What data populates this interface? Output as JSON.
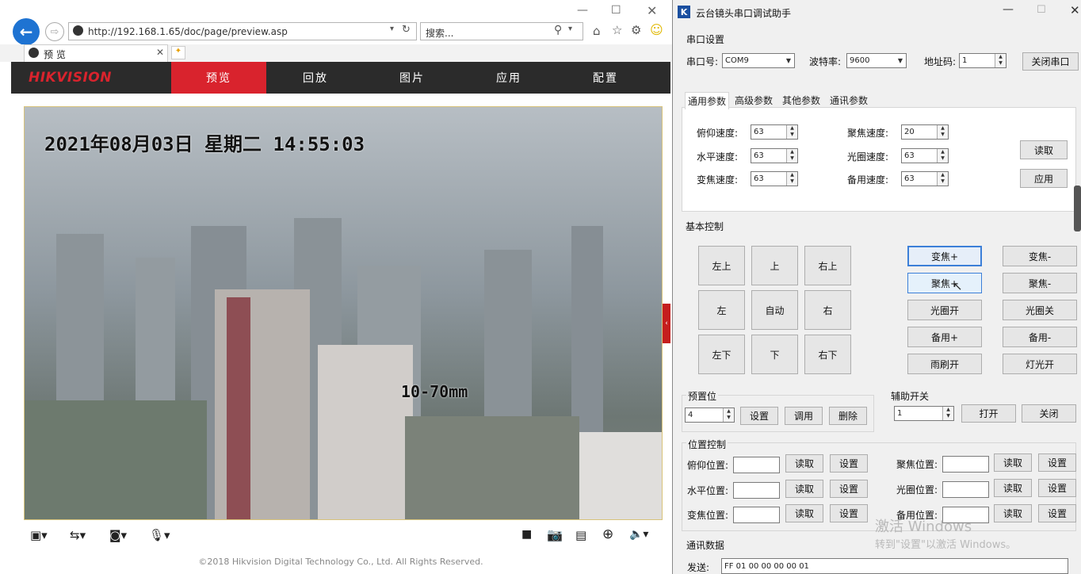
{
  "browser": {
    "url": "http://192.168.1.65/doc/page/preview.asp",
    "search_placeholder": "搜索...",
    "tab_label": "预 览",
    "back_glyph": "←",
    "forward_glyph": "⇨"
  },
  "hik": {
    "logo": "HIKVISION",
    "nav": [
      "预览",
      "回放",
      "图片",
      "应用",
      "配置"
    ],
    "active_nav": 0,
    "accent": "#d9232d",
    "osd_time": "2021年08月03日 星期二 14:55:03",
    "osd_lens": "10-70mm",
    "copyright": "©2018 Hikvision Digital Technology Co., Ltd. All Rights Reserved."
  },
  "app": {
    "title": "云台镜头串口调试助手",
    "serial": {
      "group_label": "串口设置",
      "port_label": "串口号:",
      "port_value": "COM9",
      "baud_label": "波特率:",
      "baud_value": "9600",
      "addr_label": "地址码:",
      "addr_value": "1",
      "close_button": "关闭串口"
    },
    "param_tabs": [
      "通用参数",
      "高级参数",
      "其他参数",
      "通讯参数"
    ],
    "active_tab": 0,
    "params_left": [
      {
        "label": "俯仰速度:",
        "value": "63"
      },
      {
        "label": "水平速度:",
        "value": "63"
      },
      {
        "label": "变焦速度:",
        "value": "63"
      }
    ],
    "params_right": [
      {
        "label": "聚焦速度:",
        "value": "20"
      },
      {
        "label": "光圈速度:",
        "value": "63"
      },
      {
        "label": "备用速度:",
        "value": "63"
      }
    ],
    "read_button": "读取",
    "apply_button": "应用",
    "basic": {
      "group_label": "基本控制",
      "dir_buttons": [
        "左上",
        "上",
        "右上",
        "左",
        "自动",
        "右",
        "左下",
        "下",
        "右下"
      ],
      "lens_left": [
        "变焦+",
        "聚焦+",
        "光圈开",
        "备用+",
        "雨刷开"
      ],
      "lens_right": [
        "变焦-",
        "聚焦-",
        "光圈关",
        "备用-",
        "灯光开"
      ]
    },
    "preset": {
      "group_label": "预置位",
      "value": "4",
      "buttons": [
        "设置",
        "调用",
        "删除"
      ]
    },
    "aux": {
      "group_label": "辅助开关",
      "value": "1",
      "buttons": [
        "打开",
        "关闭"
      ]
    },
    "position": {
      "group_label": "位置控制",
      "left_labels": [
        "俯仰位置:",
        "水平位置:",
        "变焦位置:"
      ],
      "right_labels": [
        "聚焦位置:",
        "光圈位置:",
        "备用位置:"
      ],
      "read": "读取",
      "set": "设置"
    },
    "comm": {
      "group_label": "通讯数据",
      "send_label": "发送:",
      "send_value": "FF 01 00 00 00 00 01"
    },
    "watermark": [
      "激活 Windows",
      "转到\"设置\"以激活 Windows。"
    ]
  }
}
